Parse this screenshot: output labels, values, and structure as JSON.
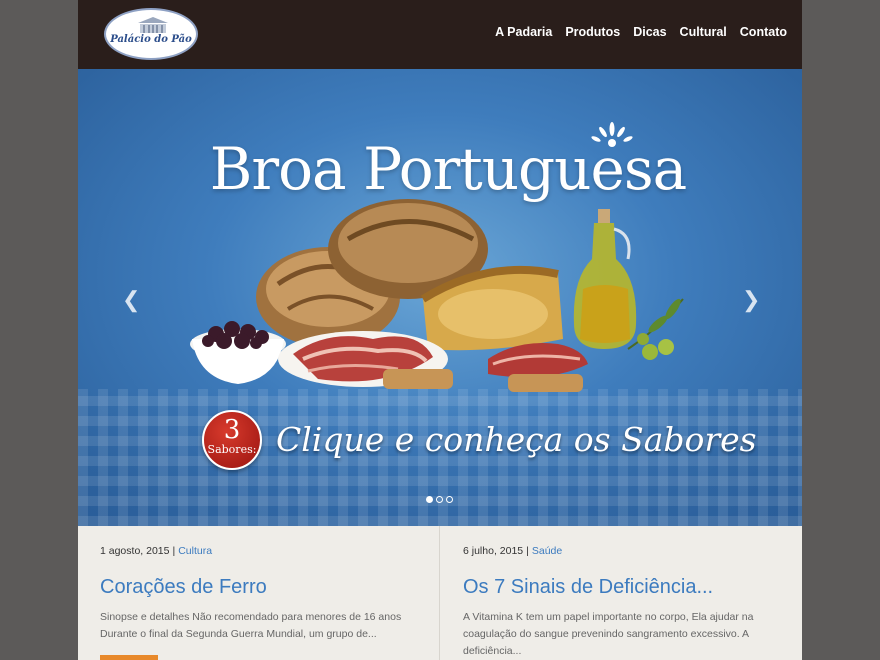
{
  "header": {
    "logo_text": "Palácio do Pão",
    "nav": [
      "A Padaria",
      "Produtos",
      "Dicas",
      "Cultural",
      "Contato"
    ]
  },
  "hero": {
    "title": "Broa Portuguesa",
    "badge_number": "3",
    "badge_text": "Sabores:",
    "cta": "Clique e conheça os Sabores",
    "slides_total": 3,
    "slide_active": 1
  },
  "posts": [
    {
      "date": "1 agosto, 2015",
      "separator": "|",
      "category": "Cultura",
      "title": "Corações de Ferro",
      "excerpt": "Sinopse e detalhes Não recomendado para menores de 16 anos Durante o final da Segunda Guerra Mundial, um grupo de..."
    },
    {
      "date": "6 julho, 2015",
      "separator": "|",
      "category": "Saúde",
      "title": "Os 7 Sinais de Deficiência...",
      "excerpt": "A Vitamina K tem um papel importante no corpo, Ela ajudar na coagulação do sangue prevenindo sangramento excessivo. A deficiência..."
    }
  ],
  "colors": {
    "header_bg": "#2a1e1b",
    "accent_blue": "#3c7bbf",
    "accent_orange": "#e8892a",
    "badge_red": "#b3221a"
  }
}
